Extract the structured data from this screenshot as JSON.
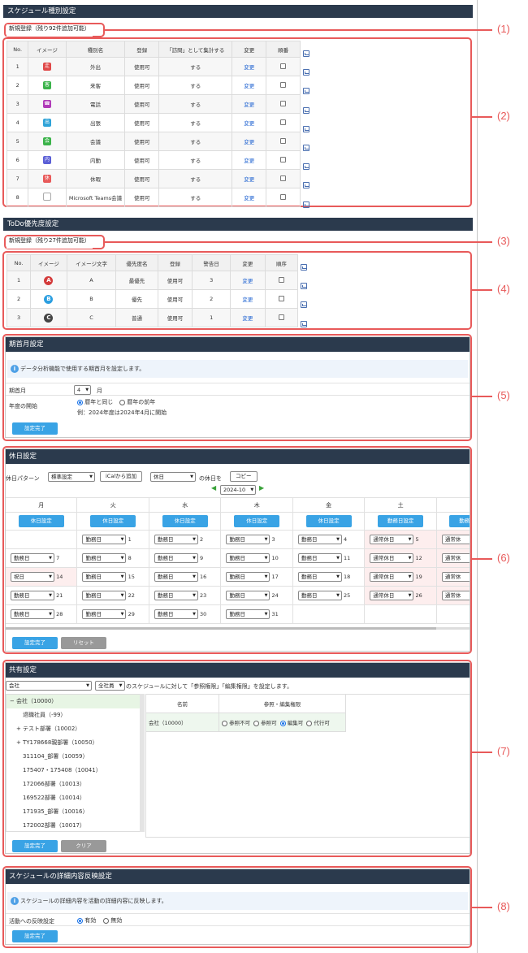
{
  "type_section": {
    "title": "スケジュール種別設定",
    "new_label": "新規登録（残り92件追加可能）",
    "headers": [
      "No.",
      "イメージ",
      "種別名",
      "登録",
      "「訪問」として集計する",
      "変更",
      "順番"
    ],
    "rows": [
      {
        "no": "1",
        "icon": "walk-icon",
        "color": "#e04848",
        "glyph": "走",
        "name": "外出",
        "reg": "使用可",
        "visit": "する",
        "edit": "変更"
      },
      {
        "no": "2",
        "icon": "guest-icon",
        "color": "#3bb34a",
        "glyph": "客",
        "name": "来客",
        "reg": "使用可",
        "visit": "する",
        "edit": "変更"
      },
      {
        "no": "3",
        "icon": "phone-icon",
        "color": "#b03ab8",
        "glyph": "☎",
        "name": "電話",
        "reg": "使用可",
        "visit": "する",
        "edit": "変更"
      },
      {
        "no": "4",
        "icon": "bag-icon",
        "color": "#2fa3d8",
        "glyph": "出",
        "name": "出張",
        "reg": "使用可",
        "visit": "する",
        "edit": "変更"
      },
      {
        "no": "5",
        "icon": "meeting-icon",
        "color": "#3bb34a",
        "glyph": "会",
        "name": "会議",
        "reg": "使用可",
        "visit": "する",
        "edit": "変更"
      },
      {
        "no": "6",
        "icon": "office-icon",
        "color": "#5b5fd6",
        "glyph": "内",
        "name": "内勤",
        "reg": "使用可",
        "visit": "する",
        "edit": "変更"
      },
      {
        "no": "7",
        "icon": "holiday-icon",
        "color": "#e85a5a",
        "glyph": "休",
        "name": "休暇",
        "reg": "使用可",
        "visit": "する",
        "edit": "変更"
      },
      {
        "no": "8",
        "icon": "broken-image-icon",
        "color": "#ffffff",
        "glyph": "",
        "name": "Microsoft Teams会議",
        "reg": "使用可",
        "visit": "する",
        "edit": "変更"
      }
    ]
  },
  "todo_section": {
    "title": "ToDo優先度設定",
    "new_label": "新規登録（残り27件追加可能）",
    "headers": [
      "No.",
      "イメージ",
      "イメージ文字",
      "優先度名",
      "登録",
      "警告日",
      "変更",
      "順序"
    ],
    "rows": [
      {
        "no": "1",
        "letter": "A",
        "color": "#d43c3c",
        "name": "最優先",
        "reg": "使用可",
        "warn": "3",
        "edit": "変更"
      },
      {
        "no": "2",
        "letter": "B",
        "color": "#2b9ee0",
        "name": "優先",
        "reg": "使用可",
        "warn": "2",
        "edit": "変更"
      },
      {
        "no": "3",
        "letter": "C",
        "color": "#444444",
        "name": "普通",
        "reg": "使用可",
        "warn": "1",
        "edit": "変更"
      }
    ]
  },
  "fiscal": {
    "title": "期首月設定",
    "info": "データ分析機能で使用する期首月を設定します。",
    "month_label": "期首月",
    "month_value": "4",
    "month_unit": "月",
    "year_label": "年度の開始",
    "opt1": "暦年と同じ",
    "opt2": "暦年の前年",
    "example": "例：2024年度は2024年4月に開始",
    "save": "設定完了"
  },
  "holiday": {
    "title": "休日設定",
    "pattern_label": "休日パターン",
    "pattern_value": "標準設定",
    "ical": "iCalから追加",
    "day_type": "休日",
    "of_label": "の休日を",
    "copy": "コピー",
    "month": "2024-10",
    "weekdays": [
      "月",
      "火",
      "水",
      "木",
      "金",
      "土"
    ],
    "set_holiday": "休日設定",
    "set_workday": "勤務日設定",
    "save": "設定完了",
    "reset": "リセット",
    "weeks": [
      [
        {
          "v": "",
          "d": ""
        },
        {
          "v": "勤務日",
          "d": "1"
        },
        {
          "v": "勤務日",
          "d": "2"
        },
        {
          "v": "勤務日",
          "d": "3"
        },
        {
          "v": "勤務日",
          "d": "4"
        },
        {
          "v": "通常休日",
          "d": "5"
        },
        {
          "v": "通常休",
          "d": ""
        }
      ],
      [
        {
          "v": "勤務日",
          "d": "7"
        },
        {
          "v": "勤務日",
          "d": "8"
        },
        {
          "v": "勤務日",
          "d": "9"
        },
        {
          "v": "勤務日",
          "d": "10"
        },
        {
          "v": "勤務日",
          "d": "11"
        },
        {
          "v": "通常休日",
          "d": "12"
        },
        {
          "v": "通常休",
          "d": ""
        }
      ],
      [
        {
          "v": "祝日",
          "d": "14"
        },
        {
          "v": "勤務日",
          "d": "15"
        },
        {
          "v": "勤務日",
          "d": "16"
        },
        {
          "v": "勤務日",
          "d": "17"
        },
        {
          "v": "勤務日",
          "d": "18"
        },
        {
          "v": "通常休日",
          "d": "19"
        },
        {
          "v": "通常休",
          "d": ""
        }
      ],
      [
        {
          "v": "勤務日",
          "d": "21"
        },
        {
          "v": "勤務日",
          "d": "22"
        },
        {
          "v": "勤務日",
          "d": "23"
        },
        {
          "v": "勤務日",
          "d": "24"
        },
        {
          "v": "勤務日",
          "d": "25"
        },
        {
          "v": "通常休日",
          "d": "26"
        },
        {
          "v": "通常休",
          "d": ""
        }
      ],
      [
        {
          "v": "勤務日",
          "d": "28"
        },
        {
          "v": "勤務日",
          "d": "29"
        },
        {
          "v": "勤務日",
          "d": "30"
        },
        {
          "v": "勤務日",
          "d": "31"
        },
        {
          "v": "",
          "d": ""
        },
        {
          "v": "",
          "d": ""
        },
        {
          "v": "",
          "d": ""
        }
      ]
    ]
  },
  "share": {
    "title": "共有設定",
    "scope": "会社",
    "who": "全社員",
    "desc": "のスケジュールに対して「参照権限」「編集権限」を設定します。",
    "tree": [
      {
        "label": "会社（10000）",
        "prefix": "−",
        "level": 0,
        "sel": true
      },
      {
        "label": "退職社員（-99）",
        "prefix": "",
        "level": 1
      },
      {
        "label": "テスト部署（10002）",
        "prefix": "+",
        "level": 1
      },
      {
        "label": "TY178668親部署（10050）",
        "prefix": "+",
        "level": 1
      },
      {
        "label": "311104_部署（10059）",
        "prefix": "",
        "level": 1
      },
      {
        "label": "175407・175408（10041）",
        "prefix": "",
        "level": 1
      },
      {
        "label": "172066部署（10013）",
        "prefix": "",
        "level": 1
      },
      {
        "label": "169522部署（10014）",
        "prefix": "",
        "level": 1
      },
      {
        "label": "171935_部署（10016）",
        "prefix": "",
        "level": 1
      },
      {
        "label": "172002部署（10017）",
        "prefix": "",
        "level": 1
      }
    ],
    "col_name": "名前",
    "col_perm": "参照・編集権限",
    "row_name": "会社（10000）",
    "perms": [
      "参照不可",
      "参照可",
      "編集可",
      "代行可"
    ],
    "save": "設定完了",
    "clear": "クリア"
  },
  "reflect": {
    "title": "スケジュールの詳細内容反映設定",
    "info": "スケジュールの詳細内容を活動の詳細内容に反映します。",
    "label": "活動への反映設定",
    "on": "有効",
    "off": "無効",
    "save": "設定完了"
  },
  "callouts": [
    "(1)",
    "(2)",
    "(3)",
    "(4)",
    "(5)",
    "(6)",
    "(7)",
    "(8)"
  ],
  "accent": "#e85a5a"
}
